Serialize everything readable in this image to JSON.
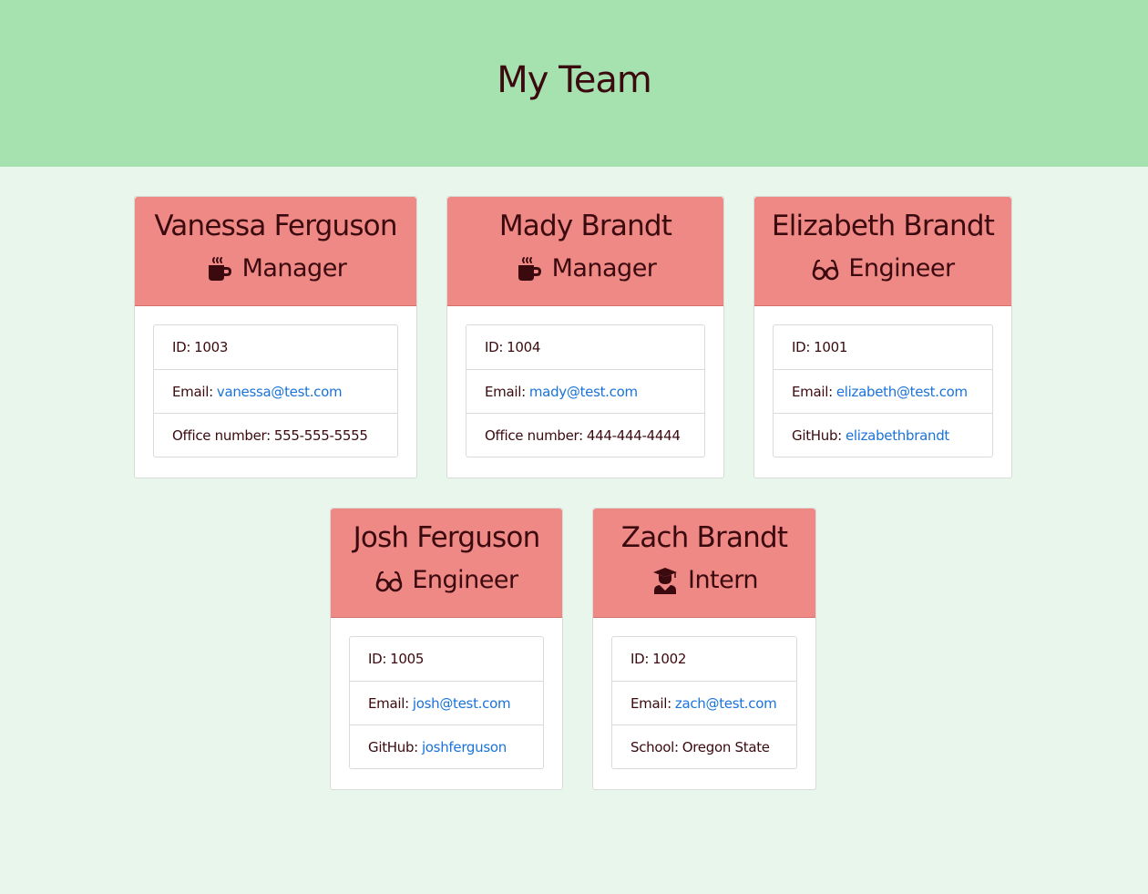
{
  "page": {
    "title": "My Team"
  },
  "colors": {
    "header_bg": "#a5e2b0",
    "page_bg": "#e9f6ec",
    "card_header_bg": "#ef8985",
    "text": "#3b0a0f",
    "link": "#1a73d9"
  },
  "employees": [
    {
      "name": "Vanessa Ferguson",
      "role": "Manager",
      "icon": "mug-icon",
      "id_label": "ID:",
      "id": "1003",
      "email_label": "Email:",
      "email": "vanessa@test.com",
      "extra_label": "Office number:",
      "extra_value": "555-555-5555"
    },
    {
      "name": "Mady Brandt",
      "role": "Manager",
      "icon": "mug-icon",
      "id_label": "ID:",
      "id": "1004",
      "email_label": "Email:",
      "email": "mady@test.com",
      "extra_label": "Office number:",
      "extra_value": "444-444-4444"
    },
    {
      "name": "Elizabeth Brandt",
      "role": "Engineer",
      "icon": "glasses-icon",
      "id_label": "ID:",
      "id": "1001",
      "email_label": "Email:",
      "email": "elizabeth@test.com",
      "extra_label": "GitHub:",
      "extra_value": "elizabethbrandt"
    },
    {
      "name": "Josh Ferguson",
      "role": "Engineer",
      "icon": "glasses-icon",
      "id_label": "ID:",
      "id": "1005",
      "email_label": "Email:",
      "email": "josh@test.com",
      "extra_label": "GitHub:",
      "extra_value": "joshferguson"
    },
    {
      "name": "Zach Brandt",
      "role": "Intern",
      "icon": "graduate-icon",
      "id_label": "ID:",
      "id": "1002",
      "email_label": "Email:",
      "email": "zach@test.com",
      "extra_label": "School:",
      "extra_value": "Oregon State"
    }
  ]
}
